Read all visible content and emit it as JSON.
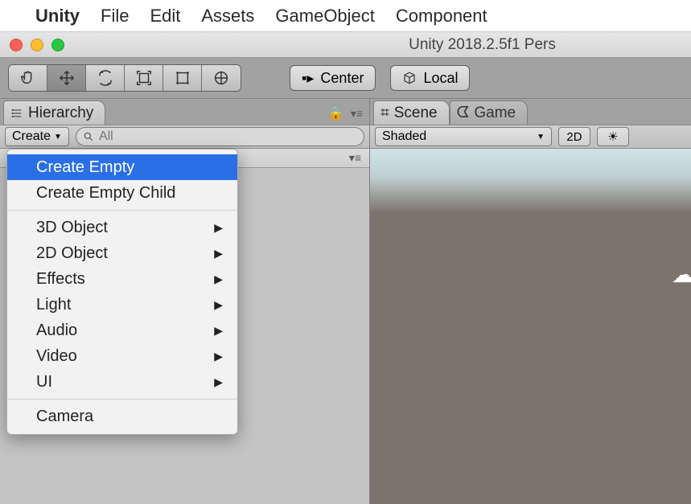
{
  "mac_menu": {
    "app": "Unity",
    "items": [
      "File",
      "Edit",
      "Assets",
      "GameObject",
      "Component"
    ]
  },
  "window": {
    "title": "Unity 2018.2.5f1 Pers"
  },
  "toolbar": {
    "pivot_label": "Center",
    "space_label": "Local"
  },
  "hierarchy": {
    "tab_label": "Hierarchy",
    "create_label": "Create",
    "search_placeholder": "All"
  },
  "context_menu": {
    "items": [
      {
        "label": "Create Empty",
        "highlight": true,
        "submenu": false
      },
      {
        "label": "Create Empty Child",
        "submenu": false
      },
      {
        "sep": true
      },
      {
        "label": "3D Object",
        "submenu": true
      },
      {
        "label": "2D Object",
        "submenu": true
      },
      {
        "label": "Effects",
        "submenu": true
      },
      {
        "label": "Light",
        "submenu": true
      },
      {
        "label": "Audio",
        "submenu": true
      },
      {
        "label": "Video",
        "submenu": true
      },
      {
        "label": "UI",
        "submenu": true
      },
      {
        "sep": true
      },
      {
        "label": "Camera",
        "submenu": false
      }
    ]
  },
  "scene": {
    "tab_scene": "Scene",
    "tab_game": "Game",
    "shading_mode": "Shaded",
    "btn_2d": "2D"
  }
}
